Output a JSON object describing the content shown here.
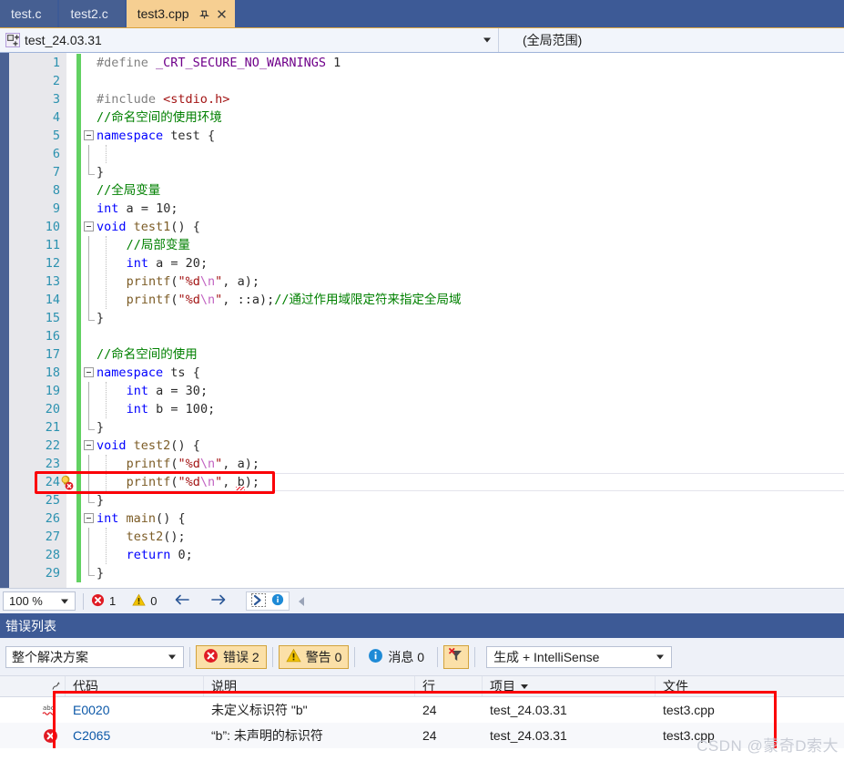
{
  "tabs": [
    {
      "label": "test.c",
      "active": false
    },
    {
      "label": "test2.c",
      "active": false
    },
    {
      "label": "test3.cpp",
      "active": true,
      "pin_icon": "pin-icon",
      "close_icon": "close-icon"
    }
  ],
  "navbar": {
    "project_icon": "cpp-project-icon",
    "project": "test_24.03.31",
    "scope": "(全局范围)",
    "dropdown_caret": "chevron-down-icon"
  },
  "editor": {
    "lines": [
      {
        "n": "1",
        "indent": 0,
        "fold": false,
        "text": "#define _CRT_SECURE_NO_WARNINGS 1"
      },
      {
        "n": "2",
        "indent": 0,
        "fold": false,
        "text": ""
      },
      {
        "n": "3",
        "indent": 0,
        "fold": false,
        "text": "#include <stdio.h>"
      },
      {
        "n": "4",
        "indent": 0,
        "fold": false,
        "text": "//命名空间的使用环境"
      },
      {
        "n": "5",
        "indent": 0,
        "fold": true,
        "text": "namespace test {"
      },
      {
        "n": "6",
        "indent": 0,
        "fold": false,
        "text": ""
      },
      {
        "n": "7",
        "indent": 0,
        "fold": false,
        "text": "}"
      },
      {
        "n": "8",
        "indent": 0,
        "fold": false,
        "text": "//全局变量"
      },
      {
        "n": "9",
        "indent": 0,
        "fold": false,
        "text": "int a = 10;"
      },
      {
        "n": "10",
        "indent": 0,
        "fold": true,
        "text": "void test1() {"
      },
      {
        "n": "11",
        "indent": 1,
        "fold": false,
        "text": "//局部变量"
      },
      {
        "n": "12",
        "indent": 1,
        "fold": false,
        "text": "int a = 20;"
      },
      {
        "n": "13",
        "indent": 1,
        "fold": false,
        "text": "printf(\"%d\\n\", a);"
      },
      {
        "n": "14",
        "indent": 1,
        "fold": false,
        "text": "printf(\"%d\\n\", ::a);//通过作用域限定符来指定全局域"
      },
      {
        "n": "15",
        "indent": 0,
        "fold": false,
        "text": "}"
      },
      {
        "n": "16",
        "indent": 0,
        "fold": false,
        "text": ""
      },
      {
        "n": "17",
        "indent": 0,
        "fold": false,
        "text": "//命名空间的使用"
      },
      {
        "n": "18",
        "indent": 0,
        "fold": true,
        "text": "namespace ts {"
      },
      {
        "n": "19",
        "indent": 1,
        "fold": false,
        "text": "int a = 30;"
      },
      {
        "n": "20",
        "indent": 1,
        "fold": false,
        "text": "int b = 100;"
      },
      {
        "n": "21",
        "indent": 0,
        "fold": false,
        "text": "}"
      },
      {
        "n": "22",
        "indent": 0,
        "fold": true,
        "text": "void test2() {"
      },
      {
        "n": "23",
        "indent": 1,
        "fold": false,
        "text": "printf(\"%d\\n\", a);"
      },
      {
        "n": "24",
        "indent": 1,
        "fold": false,
        "text": "printf(\"%d\\n\", b);"
      },
      {
        "n": "25",
        "indent": 0,
        "fold": false,
        "text": "}"
      },
      {
        "n": "26",
        "indent": 0,
        "fold": true,
        "text": "int main() {"
      },
      {
        "n": "27",
        "indent": 1,
        "fold": false,
        "text": "test2();"
      },
      {
        "n": "28",
        "indent": 1,
        "fold": false,
        "text": "return 0;"
      },
      {
        "n": "29",
        "indent": 0,
        "fold": false,
        "text": "}"
      }
    ],
    "error_line_number": "24",
    "error_glyph": "error-lightbulb-icon",
    "change_bar_color": "#62d162"
  },
  "status_bar": {
    "zoom": "100 %",
    "zoom_caret": "chevron-down-icon",
    "error_icon": "error-circle-icon",
    "error_count": "1",
    "warning_icon": "warning-triangle-icon",
    "warning_count": "0",
    "prev_icon": "arrow-left-icon",
    "next_icon": "arrow-right-icon",
    "intellisense_icon": "intellisense-icon",
    "info_icon": "info-circle-icon",
    "collapse_icon": "chevron-left-icon"
  },
  "error_list": {
    "title": "错误列表",
    "scope_filter": "整个解决方案",
    "scope_caret": "chevron-down-icon",
    "toggles": [
      {
        "icon": "error-circle-icon",
        "label": "错误 2",
        "on": true
      },
      {
        "icon": "warning-triangle-icon",
        "label": "警告 0",
        "on": true
      },
      {
        "icon": "info-circle-icon",
        "label": "消息 0",
        "on": false
      }
    ],
    "filter_icon": "clear-filter-icon",
    "build_filter": "生成 + IntelliSense",
    "build_caret": "chevron-down-icon",
    "columns": [
      "代码",
      "说明",
      "行",
      "项目",
      "文件"
    ],
    "sorted_column": "项目",
    "rows": [
      {
        "icon": "intellisense-squiggle-icon",
        "code": "E0020",
        "description": "未定义标识符 \"b\"",
        "line": "24",
        "project": "test_24.03.31",
        "file": "test3.cpp"
      },
      {
        "icon": "error-circle-icon",
        "code": "C2065",
        "description": "“b”: 未声明的标识符",
        "line": "24",
        "project": "test_24.03.31",
        "file": "test3.cpp"
      }
    ]
  },
  "watermark": "CSDN @蒙奇D索大",
  "colors": {
    "accent_blue": "#3d5a96",
    "active_tab": "#f6cf92",
    "highlight_red": "#fb0007",
    "error_red": "#e81123",
    "warning_yellow": "#f2c300",
    "link_blue": "#0c58a8",
    "change_bar_green": "#62d162"
  }
}
